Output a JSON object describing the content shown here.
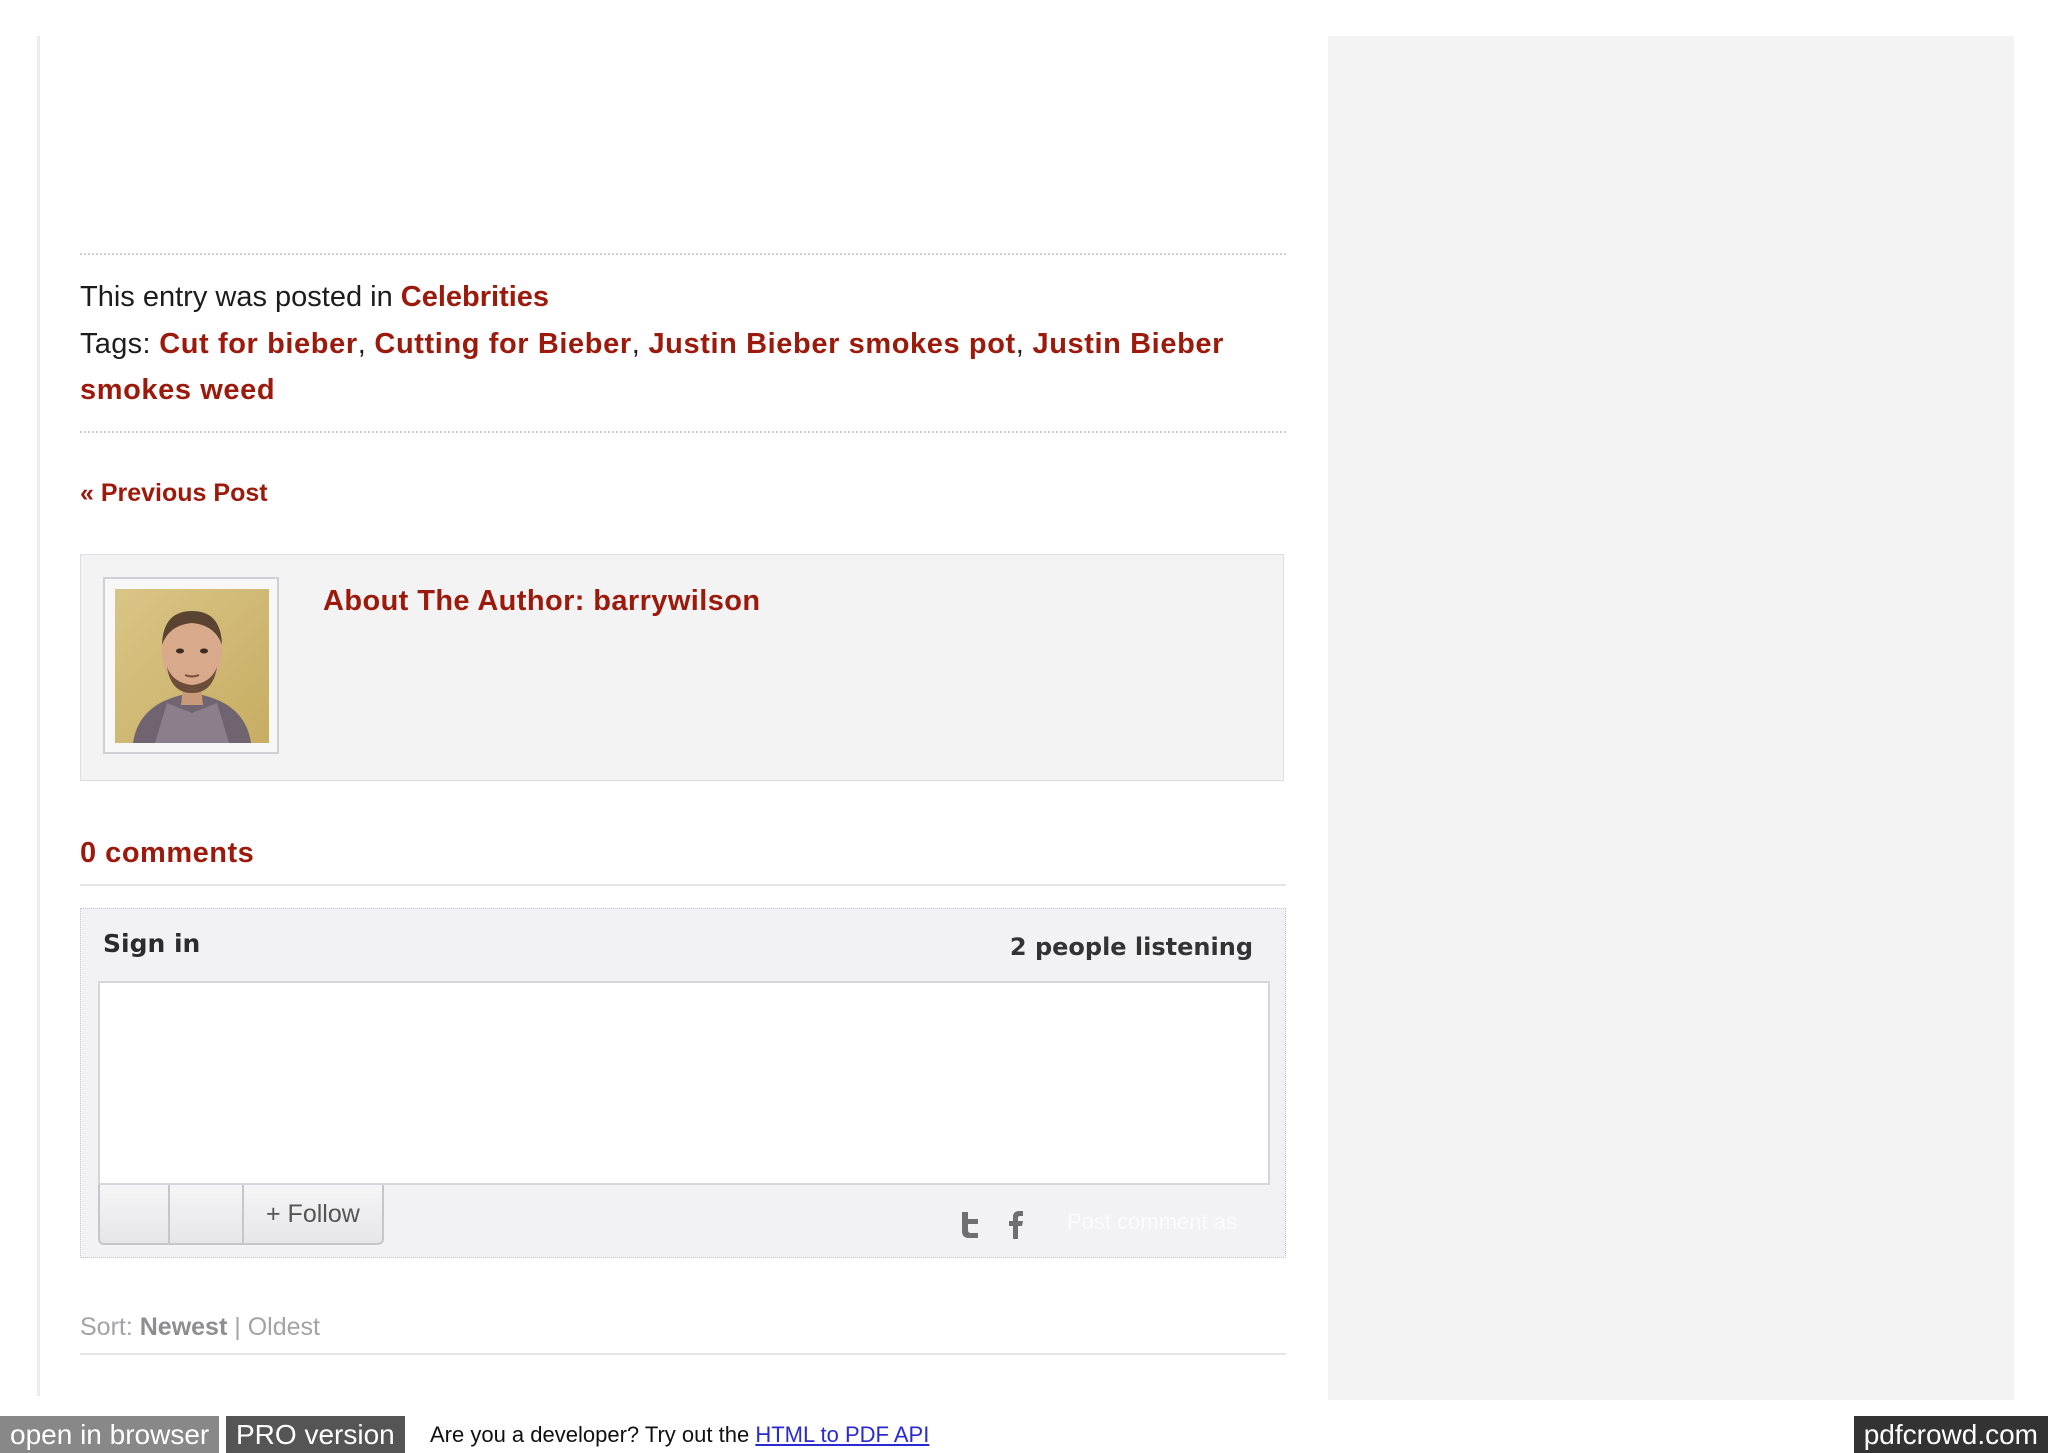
{
  "post_meta": {
    "posted_in_prefix": "This entry was posted in",
    "category": "Celebrities",
    "tags_prefix": "Tags:",
    "tags": [
      "Cut for bieber",
      "Cutting for Bieber",
      "Justin Bieber smokes pot",
      "Justin Bieber smokes weed"
    ],
    "tag_separator": ","
  },
  "navigation": {
    "previous_post": "« Previous Post"
  },
  "author_box": {
    "title": "About The Author: barrywilson"
  },
  "comments": {
    "count_label": "0 comments",
    "sign_in": "Sign in",
    "listening": "2 people listening",
    "follow_label": "+ Follow",
    "post_as": "Post comment as",
    "sort_prefix": "Sort:",
    "sort_newest": "Newest",
    "sort_divider": "|",
    "sort_oldest": "Oldest"
  },
  "pdf_bar": {
    "open_in_browser": "open in browser",
    "pro_version": "PRO version",
    "developer_prompt": "Are you a developer? Try out the",
    "api_link": "HTML to PDF API",
    "brand": "pdfcrowd.com"
  },
  "colors": {
    "accent_red": "#9b1a0c",
    "sidebar_bg": "#f3f3f4"
  },
  "icons": {
    "twitter": "twitter-icon",
    "facebook": "facebook-icon"
  }
}
